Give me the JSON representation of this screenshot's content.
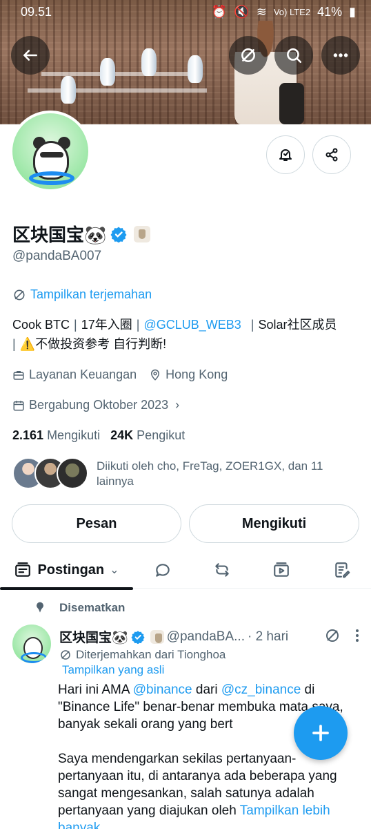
{
  "status_bar": {
    "time": "09.51",
    "battery": "41%",
    "network": "Vo) LTE2"
  },
  "profile": {
    "display_name": "区块国宝🐼",
    "handle": "@pandaBA007",
    "translate_link": "Tampilkan terjemahan",
    "bio": {
      "part1": "Cook BTC",
      "part2": "17年入圈",
      "mention": "@GCLUB_WEB3",
      "part3": "Solar社区成员",
      "part4": "⚠️不做投资参考 自行判断!"
    },
    "category": "Layanan Keuangan",
    "location": "Hong Kong",
    "joined": "Bergabung Oktober 2023",
    "following_count": "2.161",
    "following_label": "Mengikuti",
    "followers_count": "24K",
    "followers_label": "Pengikut",
    "followed_by_text": "Diikuti oleh cho, FreTag, ZOER1GX, dan 11 lainnya"
  },
  "actions": {
    "message": "Pesan",
    "following": "Mengikuti"
  },
  "tabs": {
    "active_label": "Postingan"
  },
  "pinned_post": {
    "pinned_label": "Disematkan",
    "author_name": "区块国宝🐼",
    "author_handle": "@pandaBA...",
    "time": "· 2 hari",
    "translated_from": "Diterjemahkan dari Tionghoa",
    "show_original": "Tampilkan yang asli",
    "text_1": "Hari ini AMA ",
    "mention_1": "@binance",
    "text_2": " dari ",
    "mention_2": "@cz_binance",
    "text_3": " di \"Binance Life\" benar-benar membuka mata saya, banyak sekali orang yang bert",
    "text_4": "Saya mendengarkan sekilas pertanyaan-pertanyaan itu, di antaranya ada beberapa yang sangat mengesankan, salah satunya adalah pertanyaan yang diajukan oleh ",
    "show_more": "Tampilkan lebih banyak"
  },
  "colors": {
    "accent": "#1d9bf0",
    "text": "#0f1419",
    "secondary": "#536471",
    "border": "#cfd9de"
  }
}
